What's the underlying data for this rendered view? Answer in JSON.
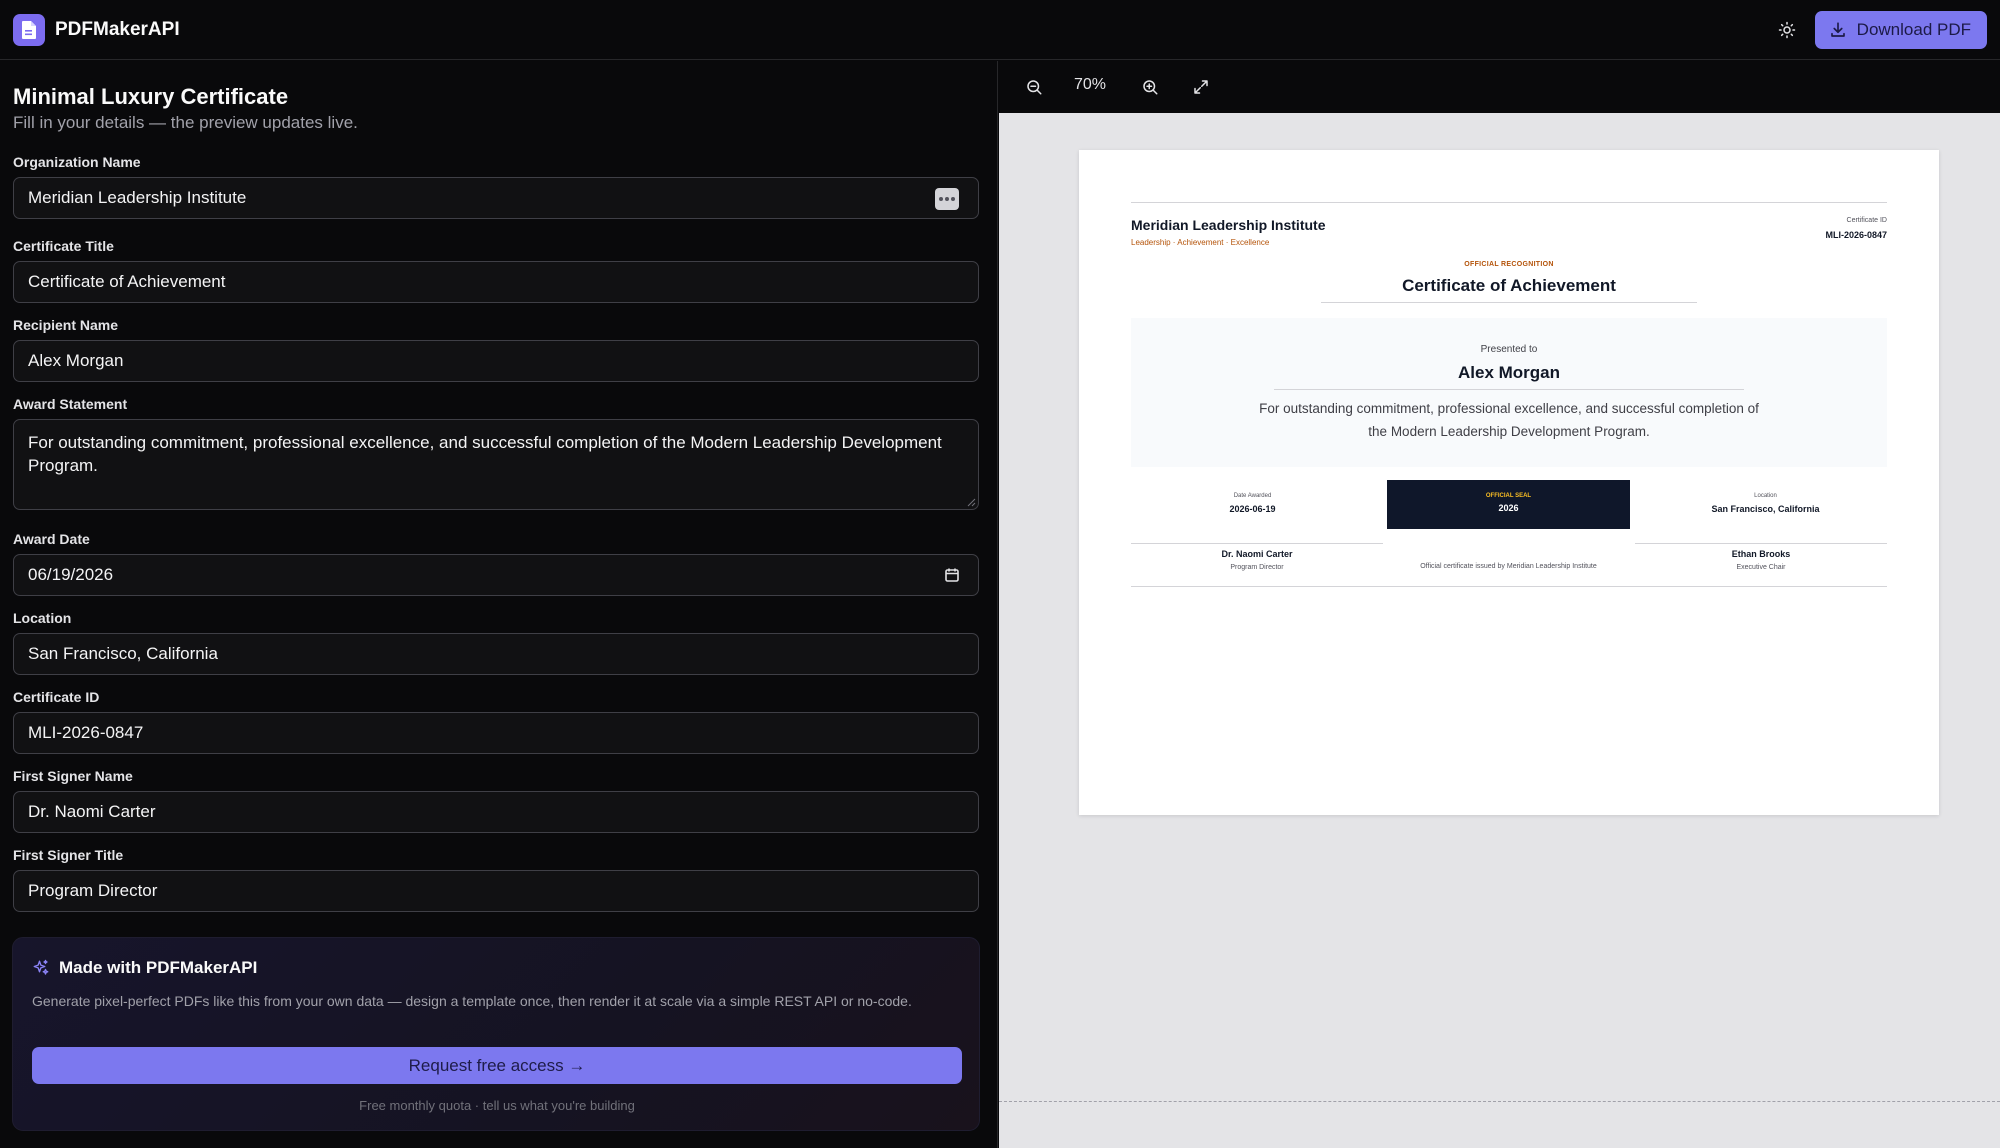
{
  "app": {
    "brand": "PDFMakerAPI",
    "download_label": "Download PDF",
    "accent_color": "#7c78ef"
  },
  "form": {
    "title": "Minimal Luxury Certificate",
    "subtitle": "Fill in your details — the preview updates live.",
    "fields": [
      {
        "label": "Organization Name",
        "value": "Meridian Leadership Institute"
      },
      {
        "label": "Certificate Title",
        "value": "Certificate of Achievement"
      },
      {
        "label": "Recipient Name",
        "value": "Alex Morgan"
      },
      {
        "label": "Award Statement",
        "value": "For outstanding commitment, professional excellence, and successful completion of the Modern Leadership Development Program."
      },
      {
        "label": "Award Date",
        "value": "06/19/2026"
      },
      {
        "label": "Location",
        "value": "San Francisco, California"
      },
      {
        "label": "Certificate ID",
        "value": "MLI-2026-0847"
      },
      {
        "label": "First Signer Name",
        "value": "Dr. Naomi Carter"
      },
      {
        "label": "First Signer Title",
        "value": "Program Director"
      }
    ]
  },
  "promo": {
    "heading": "Made with PDFMakerAPI",
    "text": "Generate pixel-perfect PDFs like this from your own data — design a template once, then render it at scale via a simple REST API or no-code.",
    "button": "Request free access →",
    "note": "Free monthly quota · tell us what you're building"
  },
  "preview": {
    "zoom": "70%",
    "certificate": {
      "org": "Meridian Leadership Institute",
      "tagline": "Leadership · Achievement · Excellence",
      "id_label": "Certificate ID",
      "id_value": "MLI-2026-0847",
      "official": "OFFICIAL RECOGNITION",
      "title": "Certificate of Achievement",
      "presented_to": "Presented to",
      "recipient": "Alex Morgan",
      "statement": "For outstanding commitment, professional excellence, and successful completion of the Modern Leadership Development Program.",
      "date_label": "Date Awarded",
      "date_value": "2026-06-19",
      "seal_label": "OFFICIAL SEAL",
      "seal_value": "2026",
      "location_label": "Location",
      "location_value": "San Francisco, California",
      "signer1_name": "Dr. Naomi Carter",
      "signer1_title": "Program Director",
      "signer2_name": "Ethan Brooks",
      "signer2_title": "Executive Chair",
      "issued_by": "Official certificate issued by Meridian Leadership Institute"
    }
  }
}
